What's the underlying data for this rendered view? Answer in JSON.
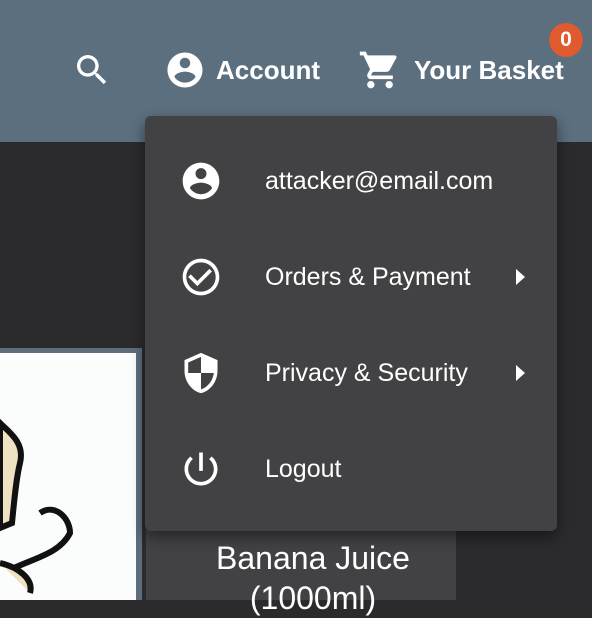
{
  "header": {
    "search_icon": "search-icon",
    "account_label": "Account",
    "account_icon": "account-circle-icon",
    "basket_label": "Your Basket",
    "basket_icon": "shopping-cart-icon",
    "basket_count": "0",
    "badge_color": "#df5a2f",
    "toolbar_color": "#5b6f7e"
  },
  "account_menu": {
    "items": [
      {
        "label": "attacker@email.com",
        "icon": "account-circle-icon"
      },
      {
        "label": "Orders & Payment",
        "icon": "check-circle-icon",
        "has_submenu": true
      },
      {
        "label": "Privacy & Security",
        "icon": "shield-icon",
        "has_submenu": true
      },
      {
        "label": "Logout",
        "icon": "power-icon"
      }
    ]
  },
  "product": {
    "name": "Banana Juice (1000ml)"
  }
}
